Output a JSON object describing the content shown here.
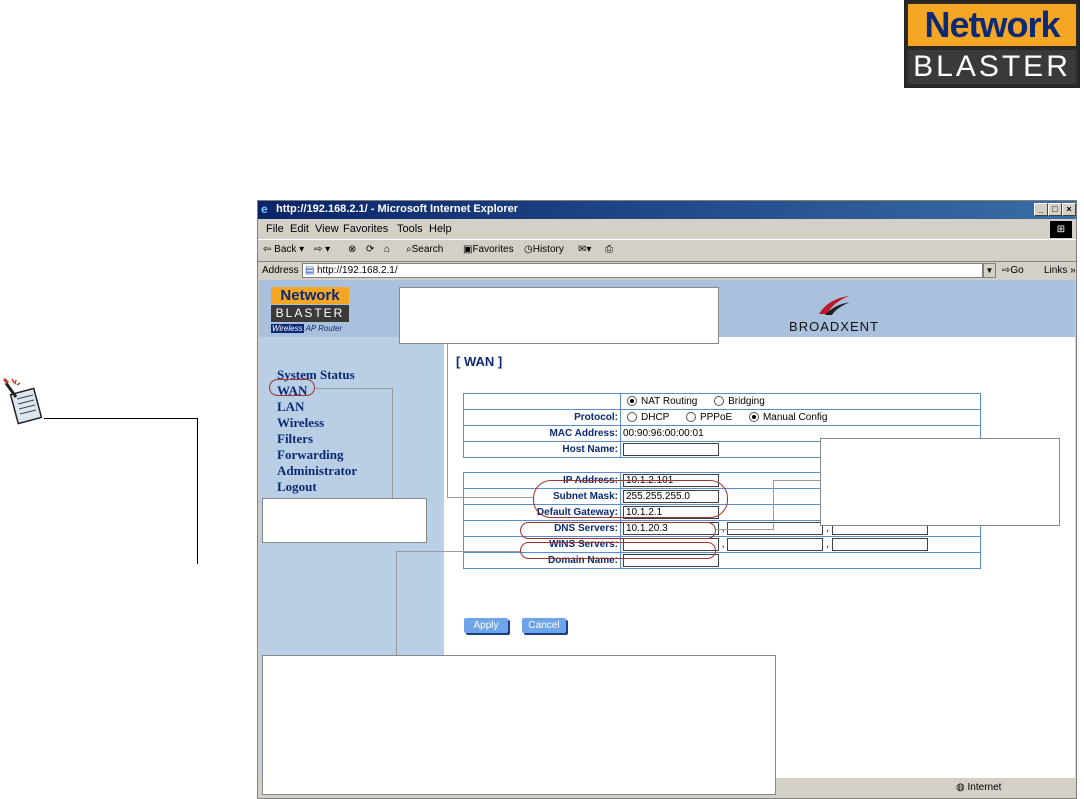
{
  "brand_logo": {
    "line1": "Network",
    "line2": "BLASTER"
  },
  "browser": {
    "title": "http://192.168.2.1/ - Microsoft Internet Explorer",
    "menu": [
      "File",
      "Edit",
      "View",
      "Favorites",
      "Tools",
      "Help"
    ],
    "toolbar": {
      "back": "Back",
      "search": "Search",
      "favorites": "Favorites",
      "history": "History"
    },
    "address_label": "Address",
    "address_value": "http://192.168.2.1/",
    "go_label": "Go",
    "links_label": "Links",
    "status_zone": "Internet"
  },
  "page": {
    "logo": {
      "line1": "Network",
      "line2": "BLASTER",
      "sub_badge": "Wireless",
      "sub_text": "AP Router"
    },
    "brand": "BROADXENT",
    "title": "[ WAN ]",
    "nav": [
      "System Status",
      "WAN",
      "LAN",
      "Wireless",
      "Filters",
      "Forwarding",
      "Administrator",
      "Logout"
    ],
    "mode_options": [
      "NAT Routing",
      "Bridging"
    ],
    "mode_selected": "NAT Routing",
    "protocol_label": "Protocol:",
    "protocol_options": [
      "DHCP",
      "PPPoE",
      "Manual Config"
    ],
    "protocol_selected": "Manual Config",
    "mac_label": "MAC Address:",
    "mac_value": "00:90:96:00:00:01",
    "host_label": "Host Name:",
    "host_value": "",
    "ip_label": "IP Address:",
    "ip_value": "10.1.2.101",
    "mask_label": "Subnet Mask:",
    "mask_value": "255.255.255.0",
    "gateway_label": "Default Gateway:",
    "gateway_value": "10.1.2.1",
    "dns_label": "DNS Servers:",
    "dns_values": [
      "10.1.20.3",
      "",
      ""
    ],
    "wins_label": "WINS Servers:",
    "wins_values": [
      "",
      "",
      ""
    ],
    "domain_label": "Domain Name:",
    "domain_value": "",
    "apply_label": "Apply",
    "cancel_label": "Cancel"
  },
  "colors": {
    "nav_text": "#0b2a73",
    "sidebar_bg": "#b8cfe6",
    "button_bg": "#6ea4e8",
    "highlight_oval": "#a0342c",
    "logo_orange": "#f5a623"
  }
}
